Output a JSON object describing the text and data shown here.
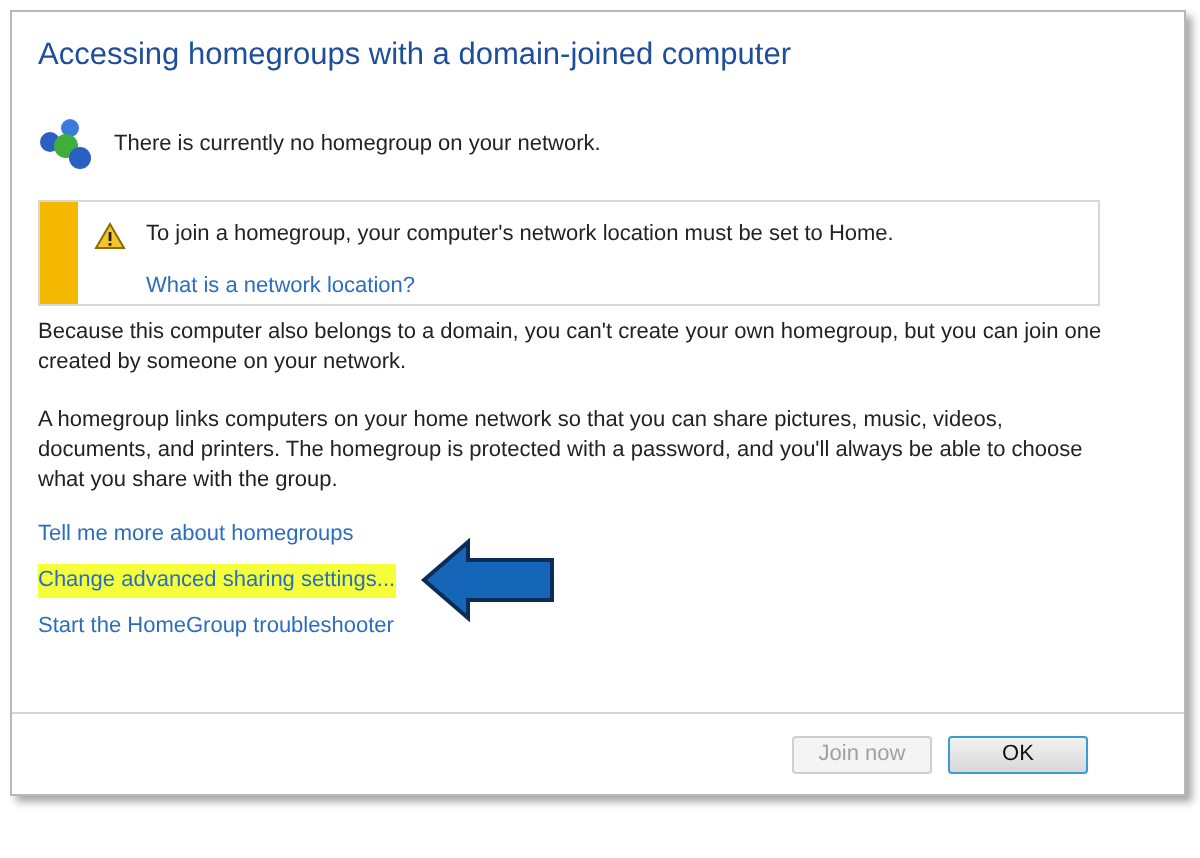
{
  "dialog": {
    "title": "Accessing homegroups with a domain-joined computer",
    "status": "There is currently no homegroup on your network.",
    "warning": {
      "message": "To join a homegroup, your computer's network location must be set to Home.",
      "link": "What is a network location?"
    },
    "paragraphs": [
      "Because this computer also belongs to a domain, you can't create your own homegroup, but you can join one created by someone on your network.",
      "A homegroup links computers on your home network so that you can share pictures, music, videos, documents, and printers. The homegroup is protected with a password, and you'll always be able to choose what you share with the group."
    ],
    "links": [
      {
        "label": "Tell me more about homegroups",
        "highlighted": false,
        "pointed": false
      },
      {
        "label": "Change advanced sharing settings...",
        "highlighted": true,
        "pointed": true
      },
      {
        "label": "Start the HomeGroup troubleshooter",
        "highlighted": false,
        "pointed": false
      }
    ],
    "buttons": [
      {
        "label": "Join now",
        "disabled": true
      },
      {
        "label": "OK",
        "disabled": false
      }
    ]
  }
}
